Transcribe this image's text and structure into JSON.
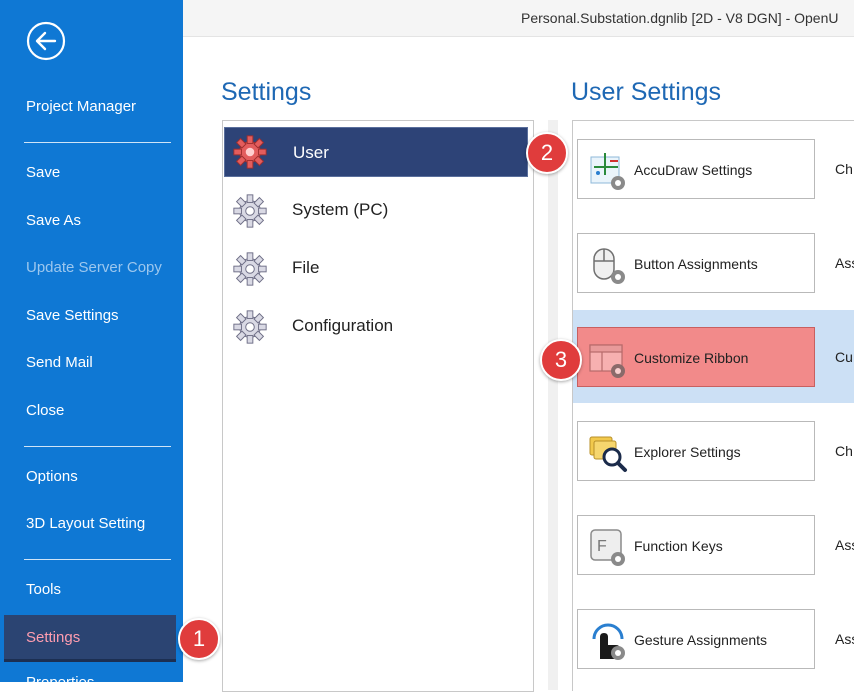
{
  "window": {
    "title": "Personal.Substation.dgnlib [2D - V8 DGN] - OpenU"
  },
  "backstage": {
    "back_icon": "back-arrow-icon",
    "items": [
      {
        "label": "Project Manager"
      },
      {
        "label": "Save"
      },
      {
        "label": "Save As"
      },
      {
        "label": "Update Server Copy"
      },
      {
        "label": "Save Settings"
      },
      {
        "label": "Send Mail"
      },
      {
        "label": "Close"
      },
      {
        "label": "Options"
      },
      {
        "label": "3D Layout Setting"
      },
      {
        "label": "Tools"
      },
      {
        "label": "Settings"
      },
      {
        "label": "Properties"
      }
    ]
  },
  "settings": {
    "heading": "Settings",
    "categories": [
      {
        "label": "User",
        "icon": "gear-icon"
      },
      {
        "label": "System (PC)",
        "icon": "gear-icon"
      },
      {
        "label": "File",
        "icon": "gear-icon"
      },
      {
        "label": "Configuration",
        "icon": "gear-icon"
      }
    ]
  },
  "user_settings": {
    "heading": "User Settings",
    "items": [
      {
        "label": "AccuDraw Settings",
        "desc": "Ch",
        "icon": "accudraw-icon"
      },
      {
        "label": "Button Assignments",
        "desc": "Ass",
        "icon": "mouse-icon"
      },
      {
        "label": "Customize Ribbon",
        "desc": "Cu",
        "icon": "ribbon-icon"
      },
      {
        "label": "Explorer Settings",
        "desc": "Ch",
        "icon": "explorer-icon"
      },
      {
        "label": "Function Keys",
        "desc": "Ass",
        "icon": "function-key-icon"
      },
      {
        "label": "Gesture Assignments",
        "desc": "Ass",
        "icon": "gesture-icon"
      }
    ]
  },
  "callouts": [
    "1",
    "2",
    "3"
  ],
  "colors": {
    "sidebar": "#0f78d4",
    "selected_category": "#2d4377",
    "highlight_button": "#f28a8a",
    "badge": "#e03c3c"
  }
}
